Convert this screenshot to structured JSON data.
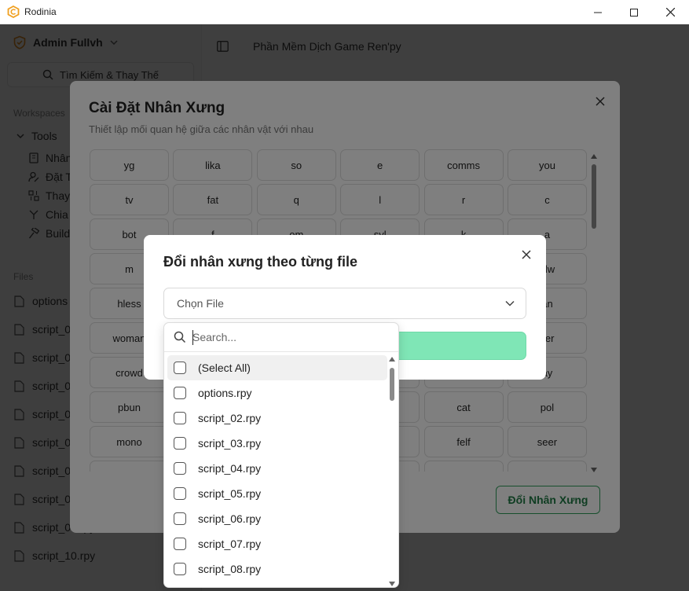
{
  "window": {
    "title": "Rodinia"
  },
  "sidebar": {
    "user": "Admin Fullvh",
    "search_label": "Tìm Kiếm & Thay Thế",
    "workspaces_label": "Workspaces",
    "tools_label": "Tools",
    "tools": [
      {
        "label": "Nhân"
      },
      {
        "label": "Đặt T"
      },
      {
        "label": "Thay"
      },
      {
        "label": "Chia"
      },
      {
        "label": "Build"
      }
    ],
    "files_label": "Files",
    "files": [
      {
        "label": "options"
      },
      {
        "label": "script_0"
      },
      {
        "label": "script_0"
      },
      {
        "label": "script_0"
      },
      {
        "label": "script_0"
      },
      {
        "label": "script_0"
      },
      {
        "label": "script_0"
      },
      {
        "label": "script_0"
      },
      {
        "label": "script_09.rpy"
      },
      {
        "label": "script_10.rpy"
      }
    ]
  },
  "main": {
    "title": "Phần Mềm Dịch Game Ren'py"
  },
  "dialog1": {
    "title": "Cài Đặt Nhân Xưng",
    "subtitle": "Thiết lập mối quan hệ giữa các nhân vật với nhau",
    "chips": [
      "yg",
      "lika",
      "so",
      "e",
      "comms",
      "you",
      "tv",
      "fat",
      "q",
      "l",
      "r",
      "c",
      "bot",
      "f",
      "om",
      "syl",
      "k",
      "a",
      "m",
      "",
      "",
      "",
      "",
      "olw",
      "hless",
      "",
      "",
      "",
      "",
      "an",
      "woman",
      "",
      "",
      "",
      "",
      "ver",
      "crowd",
      "",
      "",
      "",
      "",
      "ay",
      "pbun",
      "",
      "",
      "",
      "cat",
      "pol",
      "mono",
      "",
      "",
      "",
      "felf",
      "seer",
      "",
      "",
      "",
      "",
      "",
      ""
    ],
    "confirm_label": "Đổi Nhân Xưng"
  },
  "dialog2": {
    "title": "Đổi nhân xưng theo từng file",
    "select_placeholder": "Chọn File"
  },
  "dropdown": {
    "search_placeholder": "Search...",
    "items": [
      {
        "label": "(Select All)"
      },
      {
        "label": "options.rpy"
      },
      {
        "label": "script_02.rpy"
      },
      {
        "label": "script_03.rpy"
      },
      {
        "label": "script_04.rpy"
      },
      {
        "label": "script_05.rpy"
      },
      {
        "label": "script_06.rpy"
      },
      {
        "label": "script_07.rpy"
      },
      {
        "label": "script_08.rpy"
      }
    ]
  },
  "colors": {
    "accent_green": "#7fe6b6",
    "button_border": "#2e9e5b",
    "logo_orange": "#f0a020"
  }
}
